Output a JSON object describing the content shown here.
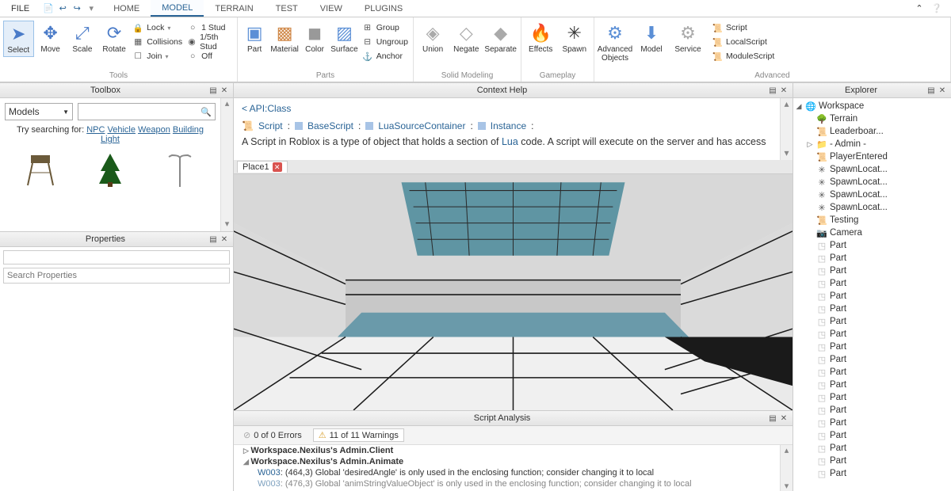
{
  "menu": {
    "file": "FILE",
    "tabs": [
      "HOME",
      "MODEL",
      "TERRAIN",
      "TEST",
      "VIEW",
      "PLUGINS"
    ],
    "active": 1
  },
  "ribbon": {
    "tools": {
      "select": "Select",
      "move": "Move",
      "scale": "Scale",
      "rotate": "Rotate",
      "lock": "Lock",
      "collisions": "Collisions",
      "join": "Join",
      "stud1": "1 Stud",
      "stud5": "1/5th Stud",
      "off": "Off",
      "label": "Tools"
    },
    "parts": {
      "part": "Part",
      "material": "Material",
      "color": "Color",
      "surface": "Surface",
      "group": "Group",
      "ungroup": "Ungroup",
      "anchor": "Anchor",
      "label": "Parts"
    },
    "solid": {
      "union": "Union",
      "negate": "Negate",
      "separate": "Separate",
      "label": "Solid Modeling"
    },
    "gameplay": {
      "effects": "Effects",
      "spawn": "Spawn",
      "label": "Gameplay"
    },
    "advanced": {
      "advobj": "Advanced\nObjects",
      "model": "Model",
      "service": "Service",
      "script": "Script",
      "localscript": "LocalScript",
      "modulescript": "ModuleScript",
      "label": "Advanced"
    }
  },
  "toolbox": {
    "title": "Toolbox",
    "dropdown": "Models",
    "hint_prefix": "Try searching for: ",
    "links": [
      "NPC",
      "Vehicle",
      "Weapon",
      "Building",
      "Light"
    ]
  },
  "properties": {
    "title": "Properties",
    "search_ph": "Search Properties"
  },
  "context": {
    "title": "Context Help",
    "crumb": "< API:Class",
    "chain": [
      "Script",
      "BaseScript",
      "LuaSourceContainer",
      "Instance"
    ],
    "desc_a": "A Script in Roblox is a type of object that holds a section of ",
    "desc_link": "Lua",
    "desc_b": " code. A script will execute on the server and has access"
  },
  "place_tab": "Place1",
  "script_analysis": {
    "title": "Script Analysis",
    "errors": "0 of 0 Errors",
    "warnings": "11 of 11 Warnings",
    "h1": "Workspace.Nexilus's Admin.Client",
    "h2": "Workspace.Nexilus's Admin.Animate",
    "w1_code": "W003",
    "w1_text": ": (464,3) Global 'desiredAngle' is only used in the enclosing function; consider changing it to local",
    "w2_code": "W003",
    "w2_text": ": (476,3) Global 'animStringValueObject' is only used in the enclosing function; consider changing it to local"
  },
  "explorer": {
    "title": "Explorer",
    "root": "Workspace",
    "items": [
      {
        "icon": "🌳",
        "label": "Terrain"
      },
      {
        "icon": "📜",
        "label": "Leaderboar..."
      },
      {
        "icon": "📁",
        "label": "- Admin -",
        "expandable": true
      },
      {
        "icon": "📜",
        "label": "PlayerEntered"
      },
      {
        "icon": "✳",
        "label": "SpawnLocat..."
      },
      {
        "icon": "✳",
        "label": "SpawnLocat..."
      },
      {
        "icon": "✳",
        "label": "SpawnLocat..."
      },
      {
        "icon": "✳",
        "label": "SpawnLocat..."
      },
      {
        "icon": "📜",
        "label": "Testing"
      },
      {
        "icon": "📷",
        "label": "Camera"
      }
    ],
    "parts_count": 19,
    "part_label": "Part"
  }
}
